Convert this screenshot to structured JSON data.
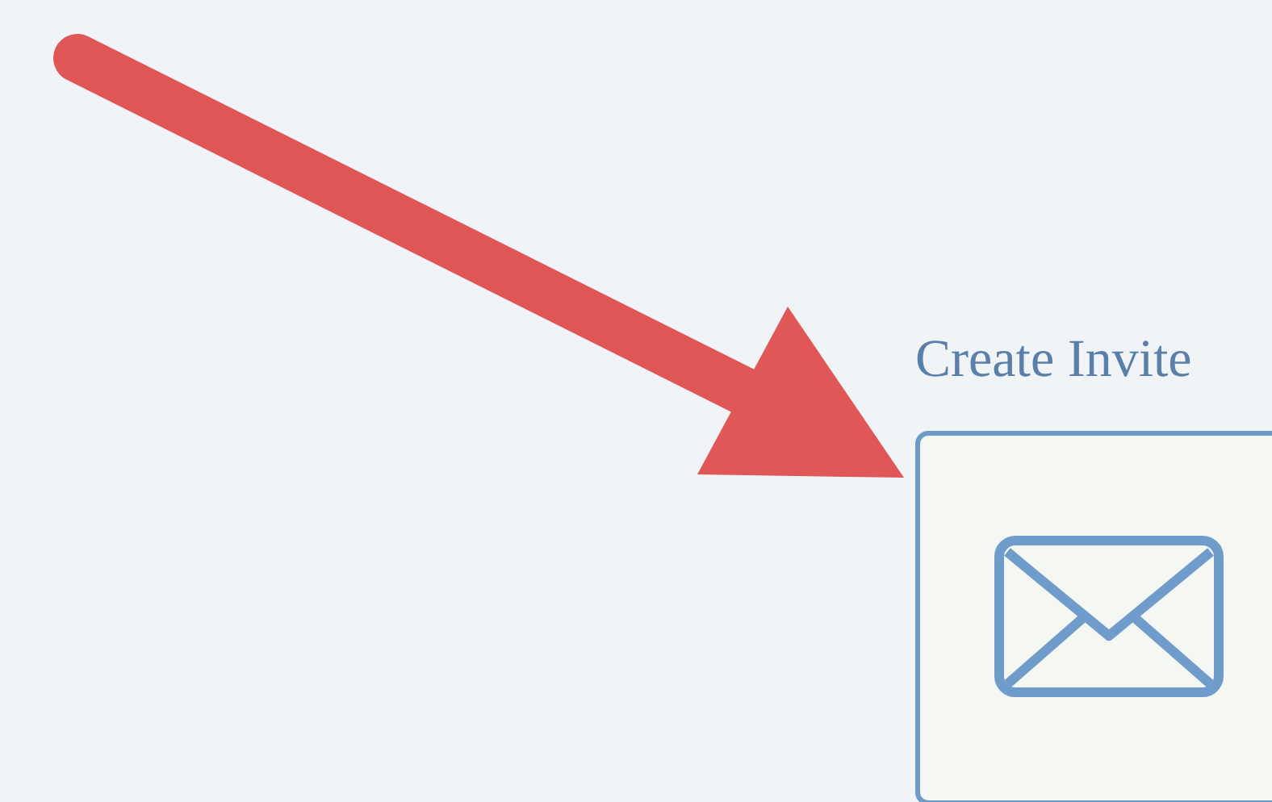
{
  "section": {
    "title": "Create Invite"
  }
}
